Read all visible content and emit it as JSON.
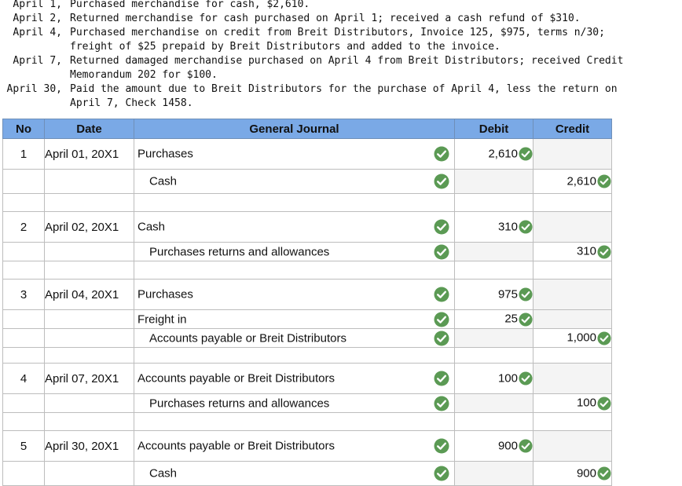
{
  "problem": [
    {
      "date": "April 1,",
      "lines": [
        "Purchased merchandise for cash, $2,610."
      ]
    },
    {
      "date": "April 2,",
      "lines": [
        "Returned merchandise for cash purchased on April 1; received a cash refund of $310."
      ]
    },
    {
      "date": "April 4,",
      "lines": [
        "Purchased merchandise on credit from Breit Distributors, Invoice 125, $975, terms n/30;",
        "freight of $25 prepaid by Breit Distributors and added to the invoice."
      ]
    },
    {
      "date": "April 7,",
      "lines": [
        "Returned damaged merchandise purchased on April 4 from Breit Distributors; received Credit",
        "Memorandum 202 for $100."
      ]
    },
    {
      "date": "April 30,",
      "lines": [
        "Paid the amount due to Breit Distributors for the purchase of April 4, less the return on",
        "April 7, Check 1458."
      ]
    }
  ],
  "headers": {
    "no": "No",
    "date": "Date",
    "journal": "General Journal",
    "debit": "Debit",
    "credit": "Credit"
  },
  "entries": [
    {
      "no": "1",
      "date": "April 01, 20X1",
      "lines": [
        {
          "account": "Purchases",
          "debit": "2,610",
          "credit": ""
        },
        {
          "account": "Cash",
          "debit": "",
          "credit": "2,610"
        }
      ]
    },
    {
      "no": "2",
      "date": "April 02, 20X1",
      "lines": [
        {
          "account": "Cash",
          "debit": "310",
          "credit": ""
        },
        {
          "account": "Purchases returns and allowances",
          "debit": "",
          "credit": "310"
        }
      ]
    },
    {
      "no": "3",
      "date": "April 04, 20X1",
      "lines": [
        {
          "account": "Purchases",
          "debit": "975",
          "credit": ""
        },
        {
          "account": "Freight in",
          "debit": "25",
          "credit": ""
        },
        {
          "account": "Accounts payable or Breit Distributors",
          "debit": "",
          "credit": "1,000"
        }
      ]
    },
    {
      "no": "4",
      "date": "April 07, 20X1",
      "lines": [
        {
          "account": "Accounts payable or Breit Distributors",
          "debit": "100",
          "credit": ""
        },
        {
          "account": "Purchases returns and allowances",
          "debit": "",
          "credit": "100"
        }
      ]
    },
    {
      "no": "5",
      "date": "April 30, 20X1",
      "lines": [
        {
          "account": "Accounts payable or Breit Distributors",
          "debit": "900",
          "credit": ""
        },
        {
          "account": "Cash",
          "debit": "",
          "credit": "900"
        }
      ]
    }
  ],
  "colors": {
    "header_bg": "#7aa9e6",
    "check_green": "#5b9a54"
  },
  "icons": {
    "correct": "check-circle-icon"
  }
}
